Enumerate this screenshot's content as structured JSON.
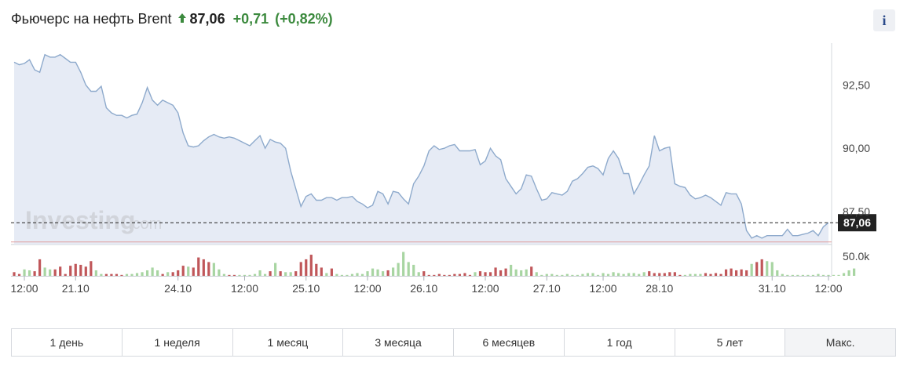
{
  "header": {
    "title": "Фьючерс на нефть Brent",
    "price": "87,06",
    "change": "+0,71",
    "change_pct": "(+0,82%)",
    "info_label": "i"
  },
  "colors": {
    "line": "#8eaacc",
    "area": "#e6ebf5",
    "up": "#3c8a3e",
    "vol_up": "#a8d5a2",
    "vol_down": "#c0575a",
    "support_line": "#e0a0a0"
  },
  "watermark": {
    "brand": "Investing",
    "suffix": ".com"
  },
  "chart_data": {
    "type": "area",
    "price": {
      "values": [
        93.4,
        93.3,
        93.35,
        93.5,
        93.1,
        93.0,
        93.7,
        93.6,
        93.6,
        93.7,
        93.55,
        93.4,
        93.4,
        93.0,
        92.5,
        92.25,
        92.25,
        92.45,
        91.6,
        91.4,
        91.3,
        91.3,
        91.2,
        91.3,
        91.35,
        91.8,
        92.4,
        91.9,
        91.7,
        91.9,
        91.8,
        91.7,
        91.4,
        90.6,
        90.1,
        90.05,
        90.1,
        90.3,
        90.45,
        90.55,
        90.45,
        90.4,
        90.45,
        90.4,
        90.3,
        90.2,
        90.1,
        90.3,
        90.5,
        90.0,
        90.35,
        90.25,
        90.2,
        90.0,
        89.1,
        88.4,
        87.7,
        88.1,
        88.2,
        87.95,
        87.95,
        88.05,
        88.05,
        87.95,
        88.05,
        88.05,
        88.1,
        87.9,
        87.8,
        87.65,
        87.75,
        88.3,
        88.2,
        87.8,
        88.3,
        88.25,
        88.0,
        87.8,
        88.6,
        88.9,
        89.3,
        89.9,
        90.1,
        89.95,
        90.0,
        90.1,
        90.15,
        89.9,
        89.9,
        89.9,
        89.95,
        89.35,
        89.5,
        90.0,
        89.7,
        89.55,
        88.8,
        88.5,
        88.2,
        88.4,
        88.95,
        88.9,
        88.4,
        87.95,
        88.0,
        88.25,
        88.2,
        88.15,
        88.3,
        88.7,
        88.8,
        89.0,
        89.25,
        89.3,
        89.2,
        88.95,
        89.6,
        89.9,
        89.6,
        89.0,
        89.0,
        88.2,
        88.55,
        88.95,
        89.3,
        90.5,
        89.9,
        90.0,
        90.05,
        88.6,
        88.5,
        88.45,
        88.15,
        88.0,
        88.05,
        88.15,
        88.05,
        87.9,
        87.75,
        88.25,
        88.2,
        88.2,
        87.8,
        86.75,
        86.45,
        86.55,
        86.45,
        86.55,
        86.55,
        86.55,
        86.55,
        86.8,
        86.55,
        86.55,
        86.6,
        86.65,
        86.75,
        86.55,
        86.9,
        87.06
      ],
      "last": 87.06,
      "support_level": 86.3,
      "y_ticks": [
        "92,50",
        "90,00",
        "87,50"
      ],
      "y_tick_values": [
        92.5,
        90.0,
        87.5
      ],
      "ylim": [
        86.2,
        94.0
      ],
      "last_label": "87,06"
    },
    "volume": {
      "values": [
        0.2,
        0.1,
        0.35,
        0.3,
        0.25,
        0.9,
        0.45,
        0.35,
        0.35,
        0.5,
        0.1,
        0.55,
        0.65,
        0.6,
        0.5,
        0.8,
        0.3,
        0.1,
        0.1,
        0.1,
        0.1,
        0.05,
        0.1,
        0.1,
        0.15,
        0.2,
        0.3,
        0.45,
        0.3,
        0.1,
        0.2,
        0.2,
        0.3,
        0.55,
        0.5,
        0.45,
        1.0,
        0.9,
        0.75,
        0.7,
        0.35,
        0.1,
        0.05,
        0.05,
        0.05,
        0.05,
        0.05,
        0.1,
        0.3,
        0.1,
        0.25,
        0.7,
        0.25,
        0.2,
        0.2,
        0.25,
        0.75,
        0.9,
        1.15,
        0.65,
        0.45,
        0.15,
        0.4,
        0.1,
        0.05,
        0.05,
        0.1,
        0.15,
        0.1,
        0.25,
        0.4,
        0.35,
        0.25,
        0.3,
        0.45,
        0.7,
        1.3,
        0.75,
        0.6,
        0.2,
        0.25,
        0.05,
        0.05,
        0.1,
        0.05,
        0.05,
        0.1,
        0.1,
        0.15,
        0.05,
        0.2,
        0.25,
        0.2,
        0.2,
        0.45,
        0.3,
        0.4,
        0.6,
        0.35,
        0.3,
        0.35,
        0.5,
        0.2,
        0.05,
        0.1,
        0.1,
        0.05,
        0.05,
        0.1,
        0.05,
        0.05,
        0.1,
        0.15,
        0.15,
        0.05,
        0.15,
        0.1,
        0.2,
        0.15,
        0.1,
        0.15,
        0.15,
        0.1,
        0.2,
        0.25,
        0.15,
        0.15,
        0.15,
        0.2,
        0.2,
        0.05,
        0.05,
        0.1,
        0.1,
        0.1,
        0.15,
        0.1,
        0.15,
        0.1,
        0.35,
        0.4,
        0.3,
        0.35,
        0.3,
        0.65,
        0.75,
        0.9,
        0.8,
        0.75,
        0.3,
        0.1,
        0.05,
        0.05,
        0.05,
        0.05,
        0.05,
        0.05,
        0.1,
        0.05,
        0.05,
        0.05,
        0.05,
        0.15,
        0.3,
        0.4
      ],
      "down": [
        1,
        1,
        0,
        0,
        1,
        1,
        0,
        0,
        1,
        1,
        1,
        1,
        1,
        1,
        1,
        1,
        0,
        0,
        1,
        1,
        1,
        1,
        0,
        0,
        0,
        0,
        0,
        0,
        0,
        1,
        0,
        1,
        1,
        1,
        0,
        1,
        1,
        1,
        1,
        0,
        0,
        0,
        1,
        1,
        0,
        0,
        0,
        0,
        0,
        0,
        1,
        0,
        1,
        0,
        0,
        1,
        1,
        1,
        1,
        1,
        1,
        0,
        1,
        0,
        0,
        0,
        0,
        0,
        0,
        0,
        0,
        0,
        0,
        1,
        0,
        0,
        0,
        0,
        0,
        0,
        1,
        1,
        1,
        1,
        1,
        1,
        1,
        1,
        1,
        1,
        0,
        1,
        1,
        1,
        1,
        1,
        1,
        0,
        0,
        0,
        0,
        1,
        0,
        0,
        0,
        0,
        0,
        0,
        0,
        0,
        0,
        0,
        0,
        0,
        0,
        0,
        0,
        0,
        0,
        0,
        0,
        0,
        0,
        0,
        1,
        1,
        1,
        1,
        1,
        1,
        1,
        0,
        0,
        0,
        0,
        1,
        1,
        1,
        1,
        1,
        1,
        1,
        1,
        1,
        0,
        1,
        1,
        0,
        0,
        0,
        0,
        0,
        0,
        0,
        0,
        0,
        0,
        0,
        0,
        0,
        0,
        0,
        0,
        0
      ],
      "label": "50.0k",
      "label_value": 1.0
    },
    "x_ticks": [
      {
        "label": "12:00",
        "i": 2
      },
      {
        "label": "21.10",
        "i": 12
      },
      {
        "label": "24.10",
        "i": 32
      },
      {
        "label": "12:00",
        "i": 45
      },
      {
        "label": "25.10",
        "i": 57
      },
      {
        "label": "12:00",
        "i": 69
      },
      {
        "label": "26.10",
        "i": 80
      },
      {
        "label": "12:00",
        "i": 92
      },
      {
        "label": "27.10",
        "i": 104
      },
      {
        "label": "12:00",
        "i": 115
      },
      {
        "label": "28.10",
        "i": 126
      },
      {
        "label": "31.10",
        "i": 148
      },
      {
        "label": "12:00",
        "i": 159
      }
    ]
  },
  "ranges": [
    "1 день",
    "1 неделя",
    "1 месяц",
    "3 месяца",
    "6 месяцев",
    "1 год",
    "5 лет",
    "Макс."
  ]
}
